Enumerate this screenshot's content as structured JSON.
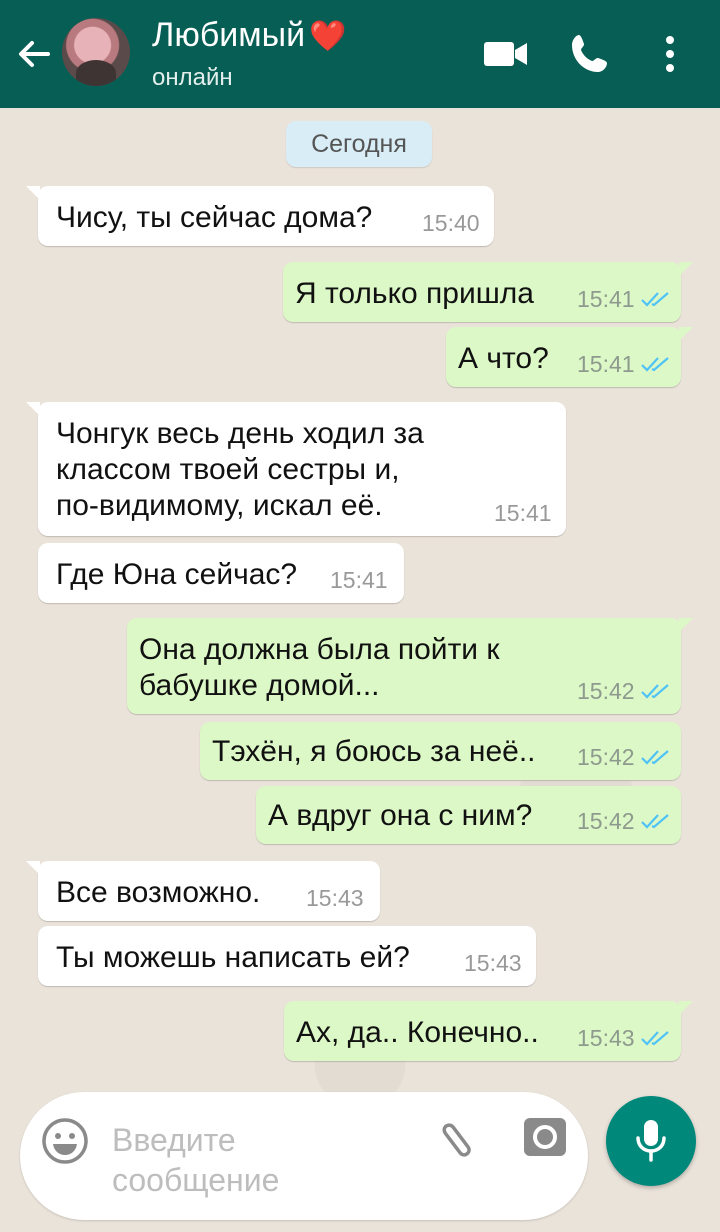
{
  "header": {
    "contact_name": "Любимый",
    "heart": "❤️",
    "status": "онлайн",
    "colors": {
      "bar": "#075e54"
    }
  },
  "chat": {
    "date_chip": "Сегодня",
    "messages": [
      {
        "dir": "in",
        "text": "Чису, ты сейчас дома?",
        "time": "15:40"
      },
      {
        "dir": "out",
        "text": "Я только пришла",
        "time": "15:41",
        "read": true
      },
      {
        "dir": "out",
        "text": "А что?",
        "time": "15:41",
        "read": true
      },
      {
        "dir": "in",
        "lines": [
          "Чонгук весь день ходил за",
          "классом твоей сестры и,",
          "по-видимому, искал её."
        ],
        "time": "15:41"
      },
      {
        "dir": "in",
        "text": "Где Юна сейчас?",
        "time": "15:41"
      },
      {
        "dir": "out",
        "lines": [
          "Она должна была пойти к",
          "бабушке домой..."
        ],
        "time": "15:42",
        "read": true
      },
      {
        "dir": "out",
        "text": "Тэхён, я боюсь за неё..",
        "time": "15:42",
        "read": true
      },
      {
        "dir": "out",
        "text": "А вдруг она с ним?",
        "time": "15:42",
        "read": true
      },
      {
        "dir": "in",
        "text": "Все возможно.",
        "time": "15:43"
      },
      {
        "dir": "in",
        "text": "Ты можешь написать ей?",
        "time": "15:43"
      },
      {
        "dir": "out",
        "text": "Ах, да.. Конечно..",
        "time": "15:43",
        "read": true
      }
    ]
  },
  "composer": {
    "placeholder_line1": "Введите",
    "placeholder_line2": "сообщение",
    "icons": [
      "emoji-icon",
      "attach-icon",
      "camera-icon",
      "mic-icon"
    ],
    "colors": {
      "send": "#00897b"
    }
  }
}
